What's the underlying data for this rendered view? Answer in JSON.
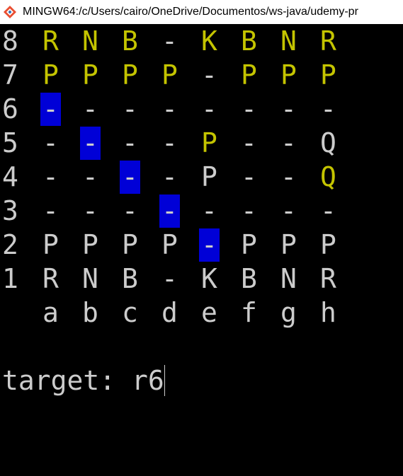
{
  "window": {
    "title": "MINGW64:/c/Users/cairo/OneDrive/Documentos/ws-java/udemy-pr"
  },
  "colors": {
    "background": "#000000",
    "white_piece": "#cccccc",
    "black_piece": "#c4c400",
    "highlight": "#0000d7"
  },
  "board": {
    "rows": [
      {
        "rank": "8",
        "cells": [
          {
            "t": "R",
            "c": "y"
          },
          {
            "t": "N",
            "c": "y"
          },
          {
            "t": "B",
            "c": "y"
          },
          {
            "t": "-",
            "c": "w"
          },
          {
            "t": "K",
            "c": "y"
          },
          {
            "t": "B",
            "c": "y"
          },
          {
            "t": "N",
            "c": "y"
          },
          {
            "t": "R",
            "c": "y"
          }
        ]
      },
      {
        "rank": "7",
        "cells": [
          {
            "t": "P",
            "c": "y"
          },
          {
            "t": "P",
            "c": "y"
          },
          {
            "t": "P",
            "c": "y"
          },
          {
            "t": "P",
            "c": "y"
          },
          {
            "t": "-",
            "c": "w"
          },
          {
            "t": "P",
            "c": "y"
          },
          {
            "t": "P",
            "c": "y"
          },
          {
            "t": "P",
            "c": "y"
          }
        ]
      },
      {
        "rank": "6",
        "cells": [
          {
            "t": "-",
            "c": "w",
            "hl": true
          },
          {
            "t": "-",
            "c": "w"
          },
          {
            "t": "-",
            "c": "w"
          },
          {
            "t": "-",
            "c": "w"
          },
          {
            "t": "-",
            "c": "w"
          },
          {
            "t": "-",
            "c": "w"
          },
          {
            "t": "-",
            "c": "w"
          },
          {
            "t": "-",
            "c": "w"
          }
        ]
      },
      {
        "rank": "5",
        "cells": [
          {
            "t": "-",
            "c": "w"
          },
          {
            "t": "-",
            "c": "w",
            "hl": true
          },
          {
            "t": "-",
            "c": "w"
          },
          {
            "t": "-",
            "c": "w"
          },
          {
            "t": "P",
            "c": "y"
          },
          {
            "t": "-",
            "c": "w"
          },
          {
            "t": "-",
            "c": "w"
          },
          {
            "t": "Q",
            "c": "w"
          }
        ]
      },
      {
        "rank": "4",
        "cells": [
          {
            "t": "-",
            "c": "w"
          },
          {
            "t": "-",
            "c": "w"
          },
          {
            "t": "-",
            "c": "w",
            "hl": true
          },
          {
            "t": "-",
            "c": "w"
          },
          {
            "t": "P",
            "c": "w"
          },
          {
            "t": "-",
            "c": "w"
          },
          {
            "t": "-",
            "c": "w"
          },
          {
            "t": "Q",
            "c": "y"
          }
        ]
      },
      {
        "rank": "3",
        "cells": [
          {
            "t": "-",
            "c": "w"
          },
          {
            "t": "-",
            "c": "w"
          },
          {
            "t": "-",
            "c": "w"
          },
          {
            "t": "-",
            "c": "w",
            "hl": true
          },
          {
            "t": "-",
            "c": "w"
          },
          {
            "t": "-",
            "c": "w"
          },
          {
            "t": "-",
            "c": "w"
          },
          {
            "t": "-",
            "c": "w"
          }
        ]
      },
      {
        "rank": "2",
        "cells": [
          {
            "t": "P",
            "c": "w"
          },
          {
            "t": "P",
            "c": "w"
          },
          {
            "t": "P",
            "c": "w"
          },
          {
            "t": "P",
            "c": "w"
          },
          {
            "t": "-",
            "c": "w",
            "hl": true
          },
          {
            "t": "P",
            "c": "w"
          },
          {
            "t": "P",
            "c": "w"
          },
          {
            "t": "P",
            "c": "w"
          }
        ]
      },
      {
        "rank": "1",
        "cells": [
          {
            "t": "R",
            "c": "w"
          },
          {
            "t": "N",
            "c": "w"
          },
          {
            "t": "B",
            "c": "w"
          },
          {
            "t": "-",
            "c": "w"
          },
          {
            "t": "K",
            "c": "w"
          },
          {
            "t": "B",
            "c": "w"
          },
          {
            "t": "N",
            "c": "w"
          },
          {
            "t": "R",
            "c": "w"
          }
        ]
      }
    ],
    "files": [
      "a",
      "b",
      "c",
      "d",
      "e",
      "f",
      "g",
      "h"
    ]
  },
  "prompt": {
    "label": "target: ",
    "value": "r6"
  }
}
